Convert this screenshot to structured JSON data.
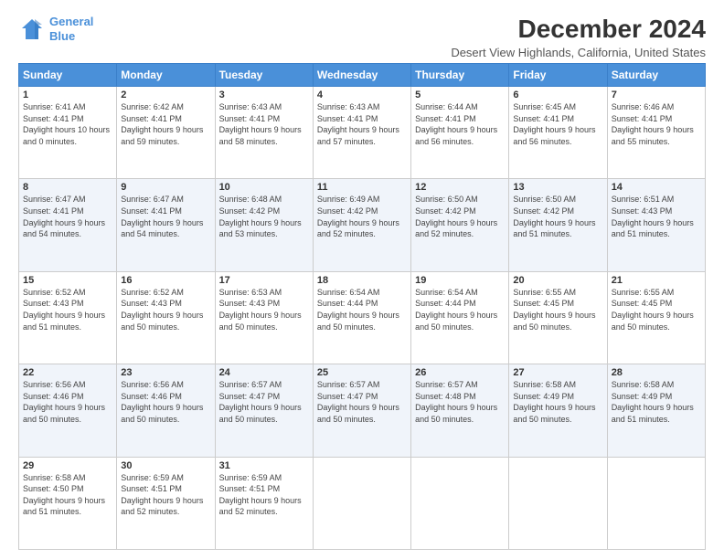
{
  "logo": {
    "line1": "General",
    "line2": "Blue"
  },
  "title": "December 2024",
  "subtitle": "Desert View Highlands, California, United States",
  "days_header": [
    "Sunday",
    "Monday",
    "Tuesday",
    "Wednesday",
    "Thursday",
    "Friday",
    "Saturday"
  ],
  "weeks": [
    [
      {
        "num": "1",
        "sunrise": "6:41 AM",
        "sunset": "4:41 PM",
        "daylight": "10 hours and 0 minutes."
      },
      {
        "num": "2",
        "sunrise": "6:42 AM",
        "sunset": "4:41 PM",
        "daylight": "9 hours and 59 minutes."
      },
      {
        "num": "3",
        "sunrise": "6:43 AM",
        "sunset": "4:41 PM",
        "daylight": "9 hours and 58 minutes."
      },
      {
        "num": "4",
        "sunrise": "6:43 AM",
        "sunset": "4:41 PM",
        "daylight": "9 hours and 57 minutes."
      },
      {
        "num": "5",
        "sunrise": "6:44 AM",
        "sunset": "4:41 PM",
        "daylight": "9 hours and 56 minutes."
      },
      {
        "num": "6",
        "sunrise": "6:45 AM",
        "sunset": "4:41 PM",
        "daylight": "9 hours and 56 minutes."
      },
      {
        "num": "7",
        "sunrise": "6:46 AM",
        "sunset": "4:41 PM",
        "daylight": "9 hours and 55 minutes."
      }
    ],
    [
      {
        "num": "8",
        "sunrise": "6:47 AM",
        "sunset": "4:41 PM",
        "daylight": "9 hours and 54 minutes."
      },
      {
        "num": "9",
        "sunrise": "6:47 AM",
        "sunset": "4:41 PM",
        "daylight": "9 hours and 54 minutes."
      },
      {
        "num": "10",
        "sunrise": "6:48 AM",
        "sunset": "4:42 PM",
        "daylight": "9 hours and 53 minutes."
      },
      {
        "num": "11",
        "sunrise": "6:49 AM",
        "sunset": "4:42 PM",
        "daylight": "9 hours and 52 minutes."
      },
      {
        "num": "12",
        "sunrise": "6:50 AM",
        "sunset": "4:42 PM",
        "daylight": "9 hours and 52 minutes."
      },
      {
        "num": "13",
        "sunrise": "6:50 AM",
        "sunset": "4:42 PM",
        "daylight": "9 hours and 51 minutes."
      },
      {
        "num": "14",
        "sunrise": "6:51 AM",
        "sunset": "4:43 PM",
        "daylight": "9 hours and 51 minutes."
      }
    ],
    [
      {
        "num": "15",
        "sunrise": "6:52 AM",
        "sunset": "4:43 PM",
        "daylight": "9 hours and 51 minutes."
      },
      {
        "num": "16",
        "sunrise": "6:52 AM",
        "sunset": "4:43 PM",
        "daylight": "9 hours and 50 minutes."
      },
      {
        "num": "17",
        "sunrise": "6:53 AM",
        "sunset": "4:43 PM",
        "daylight": "9 hours and 50 minutes."
      },
      {
        "num": "18",
        "sunrise": "6:54 AM",
        "sunset": "4:44 PM",
        "daylight": "9 hours and 50 minutes."
      },
      {
        "num": "19",
        "sunrise": "6:54 AM",
        "sunset": "4:44 PM",
        "daylight": "9 hours and 50 minutes."
      },
      {
        "num": "20",
        "sunrise": "6:55 AM",
        "sunset": "4:45 PM",
        "daylight": "9 hours and 50 minutes."
      },
      {
        "num": "21",
        "sunrise": "6:55 AM",
        "sunset": "4:45 PM",
        "daylight": "9 hours and 50 minutes."
      }
    ],
    [
      {
        "num": "22",
        "sunrise": "6:56 AM",
        "sunset": "4:46 PM",
        "daylight": "9 hours and 50 minutes."
      },
      {
        "num": "23",
        "sunrise": "6:56 AM",
        "sunset": "4:46 PM",
        "daylight": "9 hours and 50 minutes."
      },
      {
        "num": "24",
        "sunrise": "6:57 AM",
        "sunset": "4:47 PM",
        "daylight": "9 hours and 50 minutes."
      },
      {
        "num": "25",
        "sunrise": "6:57 AM",
        "sunset": "4:47 PM",
        "daylight": "9 hours and 50 minutes."
      },
      {
        "num": "26",
        "sunrise": "6:57 AM",
        "sunset": "4:48 PM",
        "daylight": "9 hours and 50 minutes."
      },
      {
        "num": "27",
        "sunrise": "6:58 AM",
        "sunset": "4:49 PM",
        "daylight": "9 hours and 50 minutes."
      },
      {
        "num": "28",
        "sunrise": "6:58 AM",
        "sunset": "4:49 PM",
        "daylight": "9 hours and 51 minutes."
      }
    ],
    [
      {
        "num": "29",
        "sunrise": "6:58 AM",
        "sunset": "4:50 PM",
        "daylight": "9 hours and 51 minutes."
      },
      {
        "num": "30",
        "sunrise": "6:59 AM",
        "sunset": "4:51 PM",
        "daylight": "9 hours and 52 minutes."
      },
      {
        "num": "31",
        "sunrise": "6:59 AM",
        "sunset": "4:51 PM",
        "daylight": "9 hours and 52 minutes."
      },
      null,
      null,
      null,
      null
    ]
  ]
}
